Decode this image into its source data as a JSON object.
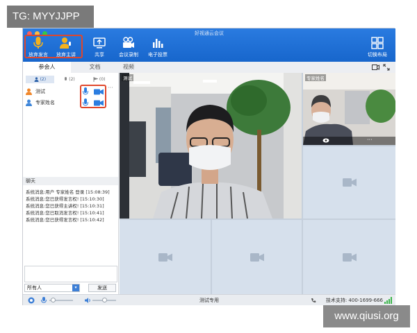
{
  "watermarks": {
    "top_left": "TG: MYYJJPP",
    "bottom_right": "www.qiusi.org"
  },
  "window": {
    "title": "好视通云会议"
  },
  "toolbar": {
    "give_up_speak": "放弃发言",
    "give_up_host": "放弃主讲",
    "share": "共享",
    "record": "会议录制",
    "vote": "电子投票",
    "layout": "切换布局"
  },
  "tabs": {
    "participants": "参会人",
    "documents": "文档",
    "video": "视频"
  },
  "participant_counts": {
    "all": "(2)",
    "speaking": "(2)",
    "hand": "(0)"
  },
  "participants": [
    {
      "name": "测试"
    },
    {
      "name": "专家姓名"
    }
  ],
  "chat": {
    "title": "聊天",
    "messages": [
      "系统消息:用户 专家姓名 登录 [15:08:39]",
      "系统消息:您已获得发言权! [15:10:30]",
      "系统消息:您已获得主讲权! [15:10:31]",
      "系统消息:您已取消发言权! [15:10:41]",
      "系统消息:您已获得发言权! [15:10:42]"
    ],
    "recipient": "所有人",
    "send_label": "发送"
  },
  "videos": {
    "main_label": "测试",
    "small_label": "专家姓名"
  },
  "status": {
    "center": "测试专用",
    "support": "技术支持: 400-1699-666"
  },
  "colors": {
    "toolbar_blue": "#1f72d9",
    "highlight_red": "#e0462b",
    "icon_blue": "#2b7de0",
    "speaker_yellow": "#f5b21c"
  },
  "icons": [
    "microphone-icon",
    "user-microphone-icon",
    "share-screen-icon",
    "video-record-icon",
    "vote-chart-icon",
    "grid-layout-icon",
    "camera-icon",
    "chat-icon",
    "signal-icon"
  ]
}
